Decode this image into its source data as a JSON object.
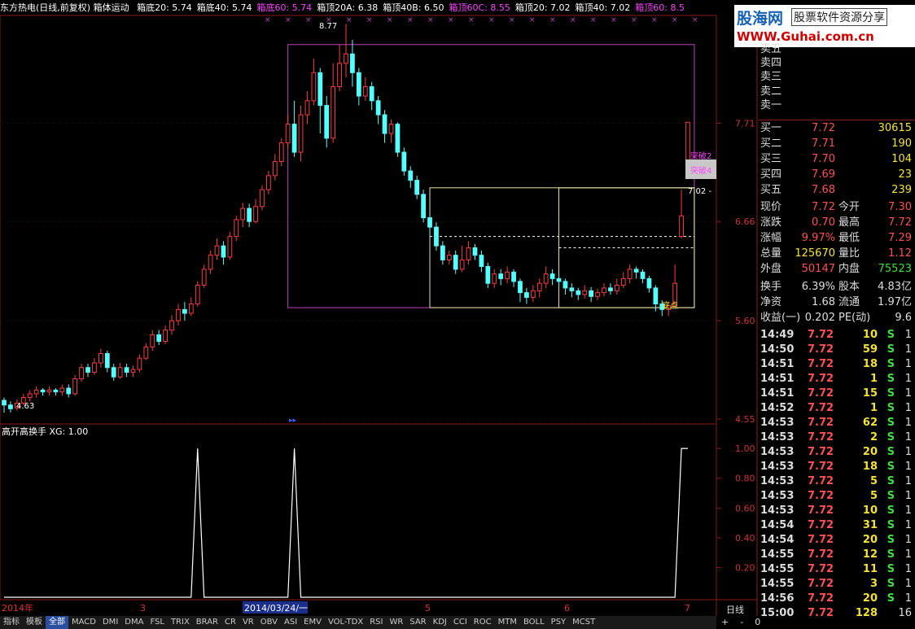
{
  "header": {
    "title": "东方热电(日线,前复权) 箱体运动",
    "items": [
      {
        "label": "箱底20: 5.74",
        "color": "#ffffff"
      },
      {
        "label": "箱底40: 5.74",
        "color": "#ffffff"
      },
      {
        "label": "箱底60: 5.74",
        "color": "#ff40ff"
      },
      {
        "label": "箱顶20A: 6.38",
        "color": "#ffffff"
      },
      {
        "label": "箱顶40B: 6.50",
        "color": "#ffffff"
      },
      {
        "label": "箱顶60C: 8.55",
        "color": "#ff40ff"
      },
      {
        "label": "箱顶20: 7.02",
        "color": "#ffffff"
      },
      {
        "label": "箱顶40: 7.02",
        "color": "#ffffff"
      },
      {
        "label": "箱顶60: 8.5",
        "color": "#ff40ff"
      }
    ]
  },
  "logo": {
    "name": "股海网",
    "slogan": "股票软件资源分享",
    "url": "WWW.Guhai.com.cn"
  },
  "chart_annotations": {
    "high_label": "8.77",
    "low_label": "4.63",
    "right_label": "7.02 -",
    "breakout_labels": [
      "突破2",
      "突破4"
    ],
    "bottom_label": "底点"
  },
  "price_axis": [
    "7.71",
    "6.66",
    "5.60",
    "4.55"
  ],
  "indicator": {
    "title": "高开高换手  XG: 1.00",
    "axis": [
      "1.00",
      "0.80",
      "0.60",
      "0.40",
      "0.20"
    ]
  },
  "time_axis": {
    "labels": [
      "2014年",
      "3",
      "2014/03/24/一",
      "5",
      "6",
      "7"
    ],
    "period": "日线"
  },
  "tabs": [
    "指标",
    "模板",
    "全部",
    "MACD",
    "DMI",
    "DMA",
    "FSL",
    "TRIX",
    "BRAR",
    "CR",
    "VR",
    "OBV",
    "ASI",
    "EMV",
    "VOL-TDX",
    "RSI",
    "WR",
    "SAR",
    "KDJ",
    "CCI",
    "ROC",
    "MTM",
    "BOLL",
    "PSY",
    "MCST"
  ],
  "bottom_controls": [
    "+",
    "-",
    "0"
  ],
  "sell_orders": [
    {
      "label": "卖五"
    },
    {
      "label": "卖四"
    },
    {
      "label": "卖三"
    },
    {
      "label": "卖二"
    },
    {
      "label": "卖一"
    }
  ],
  "buy_orders": [
    {
      "label": "买一",
      "price": "7.72",
      "vol": "30615"
    },
    {
      "label": "买二",
      "price": "7.71",
      "vol": "190"
    },
    {
      "label": "买三",
      "price": "7.70",
      "vol": "104"
    },
    {
      "label": "买四",
      "price": "7.69",
      "vol": "23"
    },
    {
      "label": "买五",
      "price": "7.68",
      "vol": "239"
    }
  ],
  "quote": [
    {
      "l1": "现价",
      "v1": "7.72",
      "l2": "今开",
      "v2": "7.30",
      "c1": "red",
      "c2": "red"
    },
    {
      "l1": "涨跌",
      "v1": "0.70",
      "l2": "最高",
      "v2": "7.72",
      "c1": "red",
      "c2": "red"
    },
    {
      "l1": "涨幅",
      "v1": "9.97%",
      "l2": "最低",
      "v2": "7.29",
      "c1": "red",
      "c2": "red"
    },
    {
      "l1": "总量",
      "v1": "125670",
      "l2": "量比",
      "v2": "1.12",
      "c1": "yellow",
      "c2": "red"
    },
    {
      "l1": "外盘",
      "v1": "50147",
      "l2": "内盘",
      "v2": "75523",
      "c1": "red",
      "c2": "green"
    }
  ],
  "fundamentals": [
    {
      "l1": "换手",
      "v1": "6.39%",
      "l2": "股本",
      "v2": "4.83亿"
    },
    {
      "l1": "净资",
      "v1": "1.68",
      "l2": "流通",
      "v2": "1.97亿"
    },
    {
      "l1": "收益(一)",
      "v1": "0.202",
      "l2": "PE(动)",
      "v2": "9.6"
    }
  ],
  "ticks": [
    {
      "time": "14:49",
      "price": "7.72",
      "vol": "10",
      "side": "S",
      "n": "1"
    },
    {
      "time": "14:50",
      "price": "7.72",
      "vol": "59",
      "side": "S",
      "n": "1"
    },
    {
      "time": "14:51",
      "price": "7.72",
      "vol": "18",
      "side": "S",
      "n": "1"
    },
    {
      "time": "14:51",
      "price": "7.72",
      "vol": "1",
      "side": "S",
      "n": "1"
    },
    {
      "time": "14:51",
      "price": "7.72",
      "vol": "15",
      "side": "S",
      "n": "1"
    },
    {
      "time": "14:52",
      "price": "7.72",
      "vol": "1",
      "side": "S",
      "n": "1"
    },
    {
      "time": "14:53",
      "price": "7.72",
      "vol": "62",
      "side": "S",
      "n": "1"
    },
    {
      "time": "14:53",
      "price": "7.72",
      "vol": "2",
      "side": "S",
      "n": "1"
    },
    {
      "time": "14:53",
      "price": "7.72",
      "vol": "20",
      "side": "S",
      "n": "1"
    },
    {
      "time": "14:53",
      "price": "7.72",
      "vol": "18",
      "side": "S",
      "n": "1"
    },
    {
      "time": "14:53",
      "price": "7.72",
      "vol": "5",
      "side": "S",
      "n": "1"
    },
    {
      "time": "14:53",
      "price": "7.72",
      "vol": "5",
      "side": "S",
      "n": "1"
    },
    {
      "time": "14:53",
      "price": "7.72",
      "vol": "10",
      "side": "S",
      "n": "1"
    },
    {
      "time": "14:54",
      "price": "7.72",
      "vol": "31",
      "side": "S",
      "n": "1"
    },
    {
      "time": "14:54",
      "price": "7.72",
      "vol": "20",
      "side": "S",
      "n": "1"
    },
    {
      "time": "14:55",
      "price": "7.72",
      "vol": "12",
      "side": "S",
      "n": "1"
    },
    {
      "time": "14:55",
      "price": "7.72",
      "vol": "11",
      "side": "S",
      "n": "1"
    },
    {
      "time": "14:55",
      "price": "7.72",
      "vol": "3",
      "side": "S",
      "n": "1"
    },
    {
      "time": "14:56",
      "price": "7.72",
      "vol": "20",
      "side": "S",
      "n": "1"
    },
    {
      "time": "15:00",
      "price": "7.72",
      "vol": "128",
      "side": "",
      "n": "16"
    }
  ],
  "chart_data": {
    "type": "candlestick",
    "ylim": [
      4.55,
      8.8
    ],
    "candles": [
      [
        4.75,
        4.7,
        4.78,
        4.62
      ],
      [
        4.7,
        4.66,
        4.74,
        4.62
      ],
      [
        4.67,
        4.72,
        4.76,
        4.64
      ],
      [
        4.72,
        4.78,
        4.82,
        4.7
      ],
      [
        4.78,
        4.82,
        4.86,
        4.74
      ],
      [
        4.82,
        4.86,
        4.9,
        4.78
      ],
      [
        4.86,
        4.84,
        4.88,
        4.8
      ],
      [
        4.84,
        4.86,
        4.9,
        4.8
      ],
      [
        4.86,
        4.84,
        4.88,
        4.8
      ],
      [
        4.84,
        4.88,
        4.92,
        4.8
      ],
      [
        4.88,
        4.82,
        4.92,
        4.78
      ],
      [
        4.82,
        4.98,
        5.02,
        4.8
      ],
      [
        4.98,
        5.1,
        5.14,
        4.95
      ],
      [
        5.1,
        5.05,
        5.14,
        5.0
      ],
      [
        5.05,
        5.15,
        5.2,
        5.02
      ],
      [
        5.15,
        5.25,
        5.3,
        5.1
      ],
      [
        5.25,
        5.1,
        5.28,
        5.05
      ],
      [
        5.1,
        5.0,
        5.14,
        4.96
      ],
      [
        5.0,
        5.1,
        5.15,
        4.98
      ],
      [
        5.1,
        5.05,
        5.14,
        5.0
      ],
      [
        5.05,
        5.08,
        5.12,
        5.0
      ],
      [
        5.08,
        5.2,
        5.24,
        5.05
      ],
      [
        5.2,
        5.32,
        5.36,
        5.18
      ],
      [
        5.32,
        5.45,
        5.5,
        5.28
      ],
      [
        5.45,
        5.38,
        5.5,
        5.34
      ],
      [
        5.38,
        5.5,
        5.55,
        5.35
      ],
      [
        5.5,
        5.6,
        5.66,
        5.45
      ],
      [
        5.6,
        5.72,
        5.78,
        5.55
      ],
      [
        5.72,
        5.68,
        5.8,
        5.6
      ],
      [
        5.68,
        5.78,
        5.85,
        5.65
      ],
      [
        5.78,
        5.98,
        6.02,
        5.75
      ],
      [
        5.98,
        6.15,
        6.2,
        5.95
      ],
      [
        6.15,
        6.3,
        6.35,
        6.1
      ],
      [
        6.3,
        6.4,
        6.48,
        6.25
      ],
      [
        6.4,
        6.28,
        6.45,
        6.2
      ],
      [
        6.28,
        6.5,
        6.55,
        6.25
      ],
      [
        6.5,
        6.68,
        6.72,
        6.45
      ],
      [
        6.68,
        6.8,
        6.86,
        6.6
      ],
      [
        6.8,
        6.66,
        6.85,
        6.6
      ],
      [
        6.66,
        6.82,
        6.9,
        6.64
      ],
      [
        6.82,
        7.0,
        7.05,
        6.78
      ],
      [
        7.0,
        7.15,
        7.2,
        6.95
      ],
      [
        7.15,
        7.3,
        7.38,
        7.1
      ],
      [
        7.3,
        7.5,
        7.55,
        7.25
      ],
      [
        7.5,
        7.7,
        7.8,
        7.45
      ],
      [
        7.7,
        7.4,
        7.95,
        7.35
      ],
      [
        7.4,
        7.8,
        7.9,
        7.3
      ],
      [
        7.8,
        7.95,
        8.05,
        7.7
      ],
      [
        7.95,
        8.25,
        8.4,
        7.9
      ],
      [
        8.25,
        7.9,
        8.3,
        7.6
      ],
      [
        7.9,
        7.55,
        8.0,
        7.45
      ],
      [
        7.55,
        8.1,
        8.35,
        7.5
      ],
      [
        8.1,
        8.35,
        8.55,
        8.05
      ],
      [
        8.35,
        8.45,
        8.77,
        8.2
      ],
      [
        8.45,
        8.25,
        8.6,
        8.1
      ],
      [
        8.25,
        8.0,
        8.3,
        7.9
      ],
      [
        8.0,
        8.1,
        8.2,
        7.95
      ],
      [
        8.1,
        7.95,
        8.15,
        7.85
      ],
      [
        7.95,
        7.8,
        8.0,
        7.7
      ],
      [
        7.8,
        7.6,
        7.85,
        7.5
      ],
      [
        7.6,
        7.7,
        7.75,
        7.5
      ],
      [
        7.7,
        7.4,
        7.72,
        7.35
      ],
      [
        7.4,
        7.2,
        7.45,
        7.15
      ],
      [
        7.2,
        7.1,
        7.25,
        7.02
      ],
      [
        7.1,
        6.95,
        7.15,
        6.9
      ],
      [
        6.95,
        6.7,
        7.0,
        6.65
      ],
      [
        6.7,
        6.6,
        6.75,
        6.5
      ],
      [
        6.6,
        6.4,
        6.65,
        6.35
      ],
      [
        6.4,
        6.25,
        6.45,
        6.2
      ],
      [
        6.25,
        6.3,
        6.35,
        6.2
      ],
      [
        6.3,
        6.15,
        6.35,
        6.1
      ],
      [
        6.15,
        6.25,
        6.4,
        6.12
      ],
      [
        6.25,
        6.38,
        6.45,
        6.2
      ],
      [
        6.38,
        6.3,
        6.42,
        6.25
      ],
      [
        6.3,
        6.18,
        6.35,
        6.12
      ],
      [
        6.18,
        6.0,
        6.22,
        5.95
      ],
      [
        6.0,
        6.1,
        6.15,
        5.95
      ],
      [
        6.1,
        6.05,
        6.15,
        5.98
      ],
      [
        6.05,
        6.12,
        6.18,
        6.0
      ],
      [
        6.12,
        6.02,
        6.15,
        5.96
      ],
      [
        6.02,
        5.9,
        6.05,
        5.8
      ],
      [
        5.9,
        5.85,
        5.95,
        5.78
      ],
      [
        5.85,
        5.92,
        5.98,
        5.8
      ],
      [
        5.92,
        6.0,
        6.05,
        5.85
      ],
      [
        6.0,
        6.1,
        6.18,
        5.95
      ],
      [
        6.1,
        6.05,
        6.15,
        5.98
      ],
      [
        6.05,
        6.02,
        6.1,
        5.95
      ],
      [
        6.02,
        5.95,
        6.05,
        5.88
      ],
      [
        5.95,
        5.92,
        6.0,
        5.85
      ],
      [
        5.92,
        5.88,
        5.95,
        5.82
      ],
      [
        5.88,
        5.92,
        5.98,
        5.84
      ],
      [
        5.92,
        5.86,
        5.96,
        5.8
      ],
      [
        5.86,
        5.9,
        5.94,
        5.82
      ],
      [
        5.9,
        5.95,
        6.0,
        5.86
      ],
      [
        5.95,
        5.92,
        6.0,
        5.88
      ],
      [
        5.92,
        5.98,
        6.05,
        5.88
      ],
      [
        5.98,
        6.05,
        6.12,
        5.95
      ],
      [
        6.05,
        6.15,
        6.2,
        6.0
      ],
      [
        6.15,
        6.12,
        6.18,
        6.05
      ],
      [
        6.12,
        6.05,
        6.15,
        6.0
      ],
      [
        6.05,
        5.95,
        6.08,
        5.9
      ],
      [
        5.95,
        5.78,
        5.98,
        5.7
      ],
      [
        5.78,
        5.72,
        5.82,
        5.65
      ],
      [
        5.72,
        5.76,
        5.8,
        5.65
      ],
      [
        5.76,
        6.0,
        6.2,
        5.74
      ],
      [
        6.5,
        6.72,
        7.0,
        6.48
      ],
      [
        7.3,
        7.72,
        7.72,
        7.29
      ]
    ],
    "boxes": [
      {
        "kind": "box60",
        "x0": 44,
        "x1": 107,
        "bottom": 5.74,
        "top": 8.55,
        "color": "#c040c0"
      },
      {
        "kind": "box40",
        "x0": 66,
        "x1": 107,
        "bottom": 5.74,
        "top": 7.02,
        "color": "#e8e0a0"
      },
      {
        "kind": "box20",
        "x0": 86,
        "x1": 107,
        "bottom": 5.74,
        "top": 7.02,
        "color": "#e8e0a0"
      }
    ],
    "dashed_levels": [
      {
        "x0": 66,
        "x1": 107,
        "value": 6.5
      },
      {
        "x0": 86,
        "x1": 107,
        "value": 6.38
      }
    ],
    "indicator": {
      "type": "line",
      "ylim": [
        0,
        1.05
      ],
      "values": [
        0,
        0,
        0,
        0,
        0,
        0,
        0,
        0,
        0,
        0,
        0,
        0,
        0,
        0,
        0,
        0,
        0,
        0,
        0,
        0,
        0,
        0,
        0,
        0,
        0,
        0,
        0,
        0,
        0,
        0,
        1,
        0,
        0,
        0,
        0,
        0,
        0,
        0,
        0,
        0,
        0,
        0,
        0,
        0,
        0,
        1,
        0,
        0,
        0,
        0,
        0,
        0,
        0,
        0,
        0,
        0,
        0,
        0,
        0,
        0,
        0,
        0,
        0,
        0,
        0,
        0,
        0,
        0,
        0,
        0,
        0,
        0,
        0,
        0,
        0,
        0,
        0,
        0,
        0,
        0,
        0,
        0,
        0,
        0,
        0,
        0,
        0,
        0,
        0,
        0,
        0,
        0,
        0,
        0,
        0,
        0,
        0,
        0,
        0,
        0,
        0,
        0,
        0,
        0,
        0,
        1,
        1
      ]
    }
  }
}
